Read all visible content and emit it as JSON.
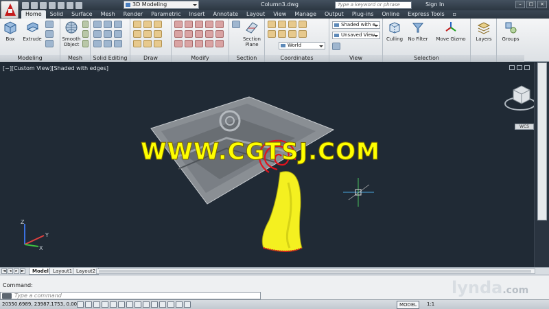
{
  "title_bar": {
    "workspace": "3D Modeling",
    "document_title": "Column3.dwg",
    "search_placeholder": "Type a keyword or phrase",
    "sign_in": "Sign In"
  },
  "ribbon_tabs": [
    "Home",
    "Solid",
    "Surface",
    "Mesh",
    "Render",
    "Parametric",
    "Insert",
    "Annotate",
    "Layout",
    "View",
    "Manage",
    "Output",
    "Plug-ins",
    "Online",
    "Express Tools"
  ],
  "active_tab": "Home",
  "ribbon_buttons": {
    "box": "Box",
    "extrude": "Extrude",
    "smooth_object": "Smooth Object",
    "section_plane": "Section Plane",
    "culling": "Culling",
    "no_filter": "No Filter",
    "move_gizmo": "Move Gizmo",
    "layers": "Layers",
    "groups": "Groups"
  },
  "ribbon_combos": {
    "visual_style": "Shaded with e...",
    "saved_view": "Unsaved View",
    "ucs": "World"
  },
  "panels": {
    "modeling": "Modeling",
    "mesh": "Mesh",
    "solid_editing": "Solid Editing",
    "draw": "Draw",
    "modify": "Modify",
    "section": "Section",
    "coordinates": "Coordinates",
    "view": "View",
    "selection": "Selection"
  },
  "viewport": {
    "label": "[−][Custom View][Shaded with edges]",
    "watermark": "WWW.CGTSJ.COM",
    "wcs_label": "WCS",
    "axis_x": "X",
    "axis_y": "Y",
    "axis_z": "Z"
  },
  "layout_tabs": [
    "Model",
    "Layout1",
    "Layout2"
  ],
  "command": {
    "history": "Command:",
    "placeholder": "Type a command"
  },
  "status": {
    "coordinates": "20350.6989, 23987.1753, 0.0000",
    "model": "MODEL",
    "scale": "1:1"
  },
  "branding": {
    "name": "lynda",
    "suffix": ".com"
  },
  "colors": {
    "viewport_bg": "#202a35",
    "column_yellow": "#f4f020",
    "accent_red": "#e0141e",
    "watermark": "#ffff00"
  }
}
